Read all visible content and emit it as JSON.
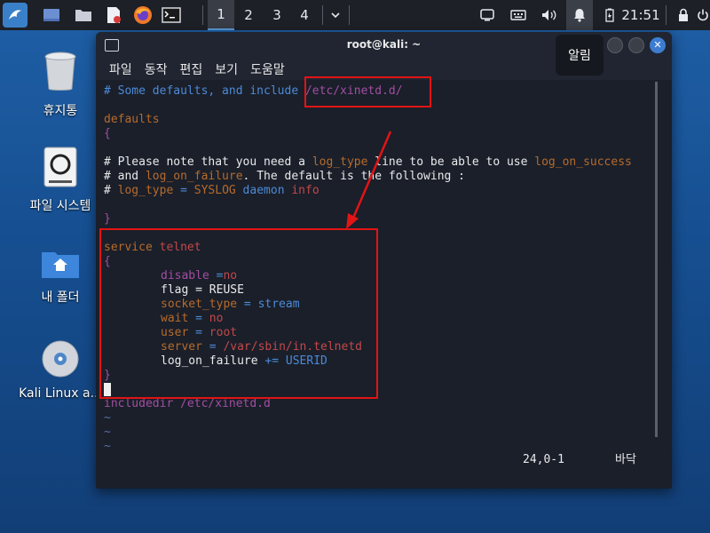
{
  "taskbar": {
    "workspaces": [
      "1",
      "2",
      "3",
      "4"
    ],
    "active_workspace": "1",
    "clock": "21:51"
  },
  "desktop": {
    "icons": [
      {
        "label": "휴지통",
        "icon": "trash-icon"
      },
      {
        "label": "파일 시스템",
        "icon": "drive-icon"
      },
      {
        "label": "내 폴더",
        "icon": "home-folder-icon"
      },
      {
        "label": "Kali Linux a...",
        "icon": "disc-icon"
      }
    ]
  },
  "window": {
    "title": "root@kali: ~",
    "menu": [
      "파일",
      "동작",
      "편집",
      "보기",
      "도움말"
    ]
  },
  "notification": "알림",
  "editor": {
    "l1": {
      "a": "# Some defaults, and include ",
      "b": "/etc/xinetd.d/"
    },
    "l2": "defaults",
    "l3": "{",
    "l4": {
      "a": "# Please note that you need a ",
      "b": "log_type",
      "c": " line to be able to use ",
      "d": "log_on_success"
    },
    "l5": {
      "a": "# and ",
      "b": "log_on_failure",
      "c": ". The default is the following :"
    },
    "l6": {
      "a": "# ",
      "b": "log_type",
      "c": " = ",
      "d": "SYSLOG",
      "e": " daemon ",
      "f": "info"
    },
    "l7": "}",
    "l8": {
      "a": "service",
      "b": " telnet"
    },
    "l9": "{",
    "l10": {
      "a": "disable",
      "b": " =",
      "c": "no"
    },
    "l11": "flag = REUSE",
    "l12": {
      "a": "socket_type",
      "b": " = ",
      "c": "stream"
    },
    "l13": {
      "a": "wait",
      "b": " = ",
      "c": "no"
    },
    "l14": {
      "a": "user",
      "b": " = ",
      "c": "root"
    },
    "l15": {
      "a": "server",
      "b": " = ",
      "c": "/var/sbin/in.telnetd"
    },
    "l16": {
      "a": "log_on_failure",
      "b": " += ",
      "c": "USERID"
    },
    "l17": "}",
    "l18": {
      "a": "includedir",
      "b": " /etc/xinetd.d"
    },
    "tilde": "~",
    "position": "24,0-1",
    "scroll_pos": "바닥"
  }
}
